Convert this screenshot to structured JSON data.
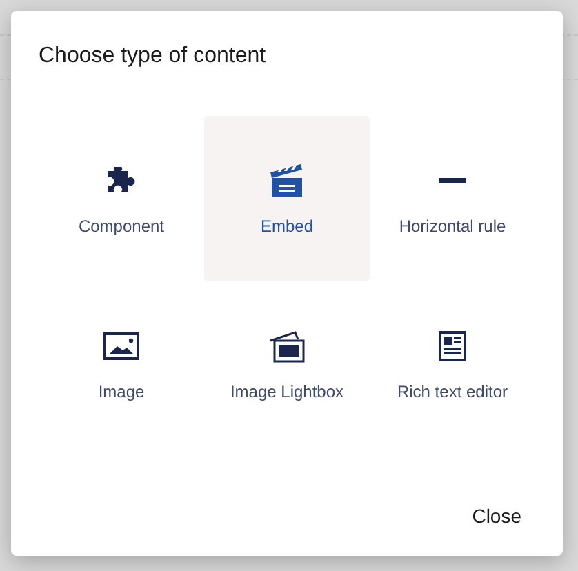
{
  "dialog": {
    "title": "Choose type of content",
    "items": [
      {
        "kind": "puzzle",
        "label": "Component",
        "selected": false
      },
      {
        "kind": "clapper",
        "label": "Embed",
        "selected": true
      },
      {
        "kind": "rule",
        "label": "Horizontal rule",
        "selected": false
      },
      {
        "kind": "image",
        "label": "Image",
        "selected": false
      },
      {
        "kind": "lightbox",
        "label": "Image Lightbox",
        "selected": false
      },
      {
        "kind": "richtext",
        "label": "Rich text editor",
        "selected": false
      }
    ],
    "close_button": "Close"
  }
}
